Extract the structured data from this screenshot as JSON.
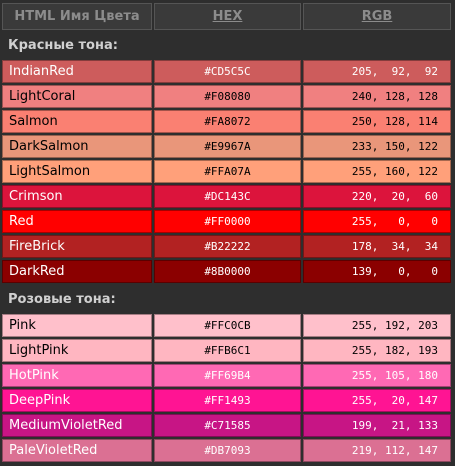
{
  "header": {
    "name": "HTML Имя Цвета",
    "hex": "HEX",
    "rgb": "RGB"
  },
  "sections": [
    {
      "title": "Красные тона:",
      "rows": [
        {
          "name": "IndianRed",
          "hex": "#CD5C5C",
          "rgb": "205,  92,  92",
          "color": "#CD5C5C",
          "text_color": "#ffffff"
        },
        {
          "name": "LightCoral",
          "hex": "#F08080",
          "rgb": "240, 128, 128",
          "color": "#F08080",
          "text_color": "#000000"
        },
        {
          "name": "Salmon",
          "hex": "#FA8072",
          "rgb": "250, 128, 114",
          "color": "#FA8072",
          "text_color": "#000000"
        },
        {
          "name": "DarkSalmon",
          "hex": "#E9967A",
          "rgb": "233, 150, 122",
          "color": "#E9967A",
          "text_color": "#000000"
        },
        {
          "name": "LightSalmon",
          "hex": "#FFA07A",
          "rgb": "255, 160, 122",
          "color": "#FFA07A",
          "text_color": "#000000"
        },
        {
          "name": "Crimson",
          "hex": "#DC143C",
          "rgb": "220,  20,  60",
          "color": "#DC143C",
          "text_color": "#ffffff"
        },
        {
          "name": "Red",
          "hex": "#FF0000",
          "rgb": "255,   0,   0",
          "color": "#FF0000",
          "text_color": "#ffffff"
        },
        {
          "name": "FireBrick",
          "hex": "#B22222",
          "rgb": "178,  34,  34",
          "color": "#B22222",
          "text_color": "#ffffff"
        },
        {
          "name": "DarkRed",
          "hex": "#8B0000",
          "rgb": "139,   0,   0",
          "color": "#8B0000",
          "text_color": "#ffffff"
        }
      ]
    },
    {
      "title": "Розовые тона:",
      "rows": [
        {
          "name": "Pink",
          "hex": "#FFC0CB",
          "rgb": "255, 192, 203",
          "color": "#FFC0CB",
          "text_color": "#000000"
        },
        {
          "name": "LightPink",
          "hex": "#FFB6C1",
          "rgb": "255, 182, 193",
          "color": "#FFB6C1",
          "text_color": "#000000"
        },
        {
          "name": "HotPink",
          "hex": "#FF69B4",
          "rgb": "255, 105, 180",
          "color": "#FF69B4",
          "text_color": "#ffffff"
        },
        {
          "name": "DeepPink",
          "hex": "#FF1493",
          "rgb": "255,  20, 147",
          "color": "#FF1493",
          "text_color": "#ffffff"
        },
        {
          "name": "MediumVioletRed",
          "hex": "#C71585",
          "rgb": "199,  21, 133",
          "color": "#C71585",
          "text_color": "#ffffff"
        },
        {
          "name": "PaleVioletRed",
          "hex": "#DB7093",
          "rgb": "219, 112, 147",
          "color": "#DB7093",
          "text_color": "#ffffff"
        }
      ]
    }
  ]
}
